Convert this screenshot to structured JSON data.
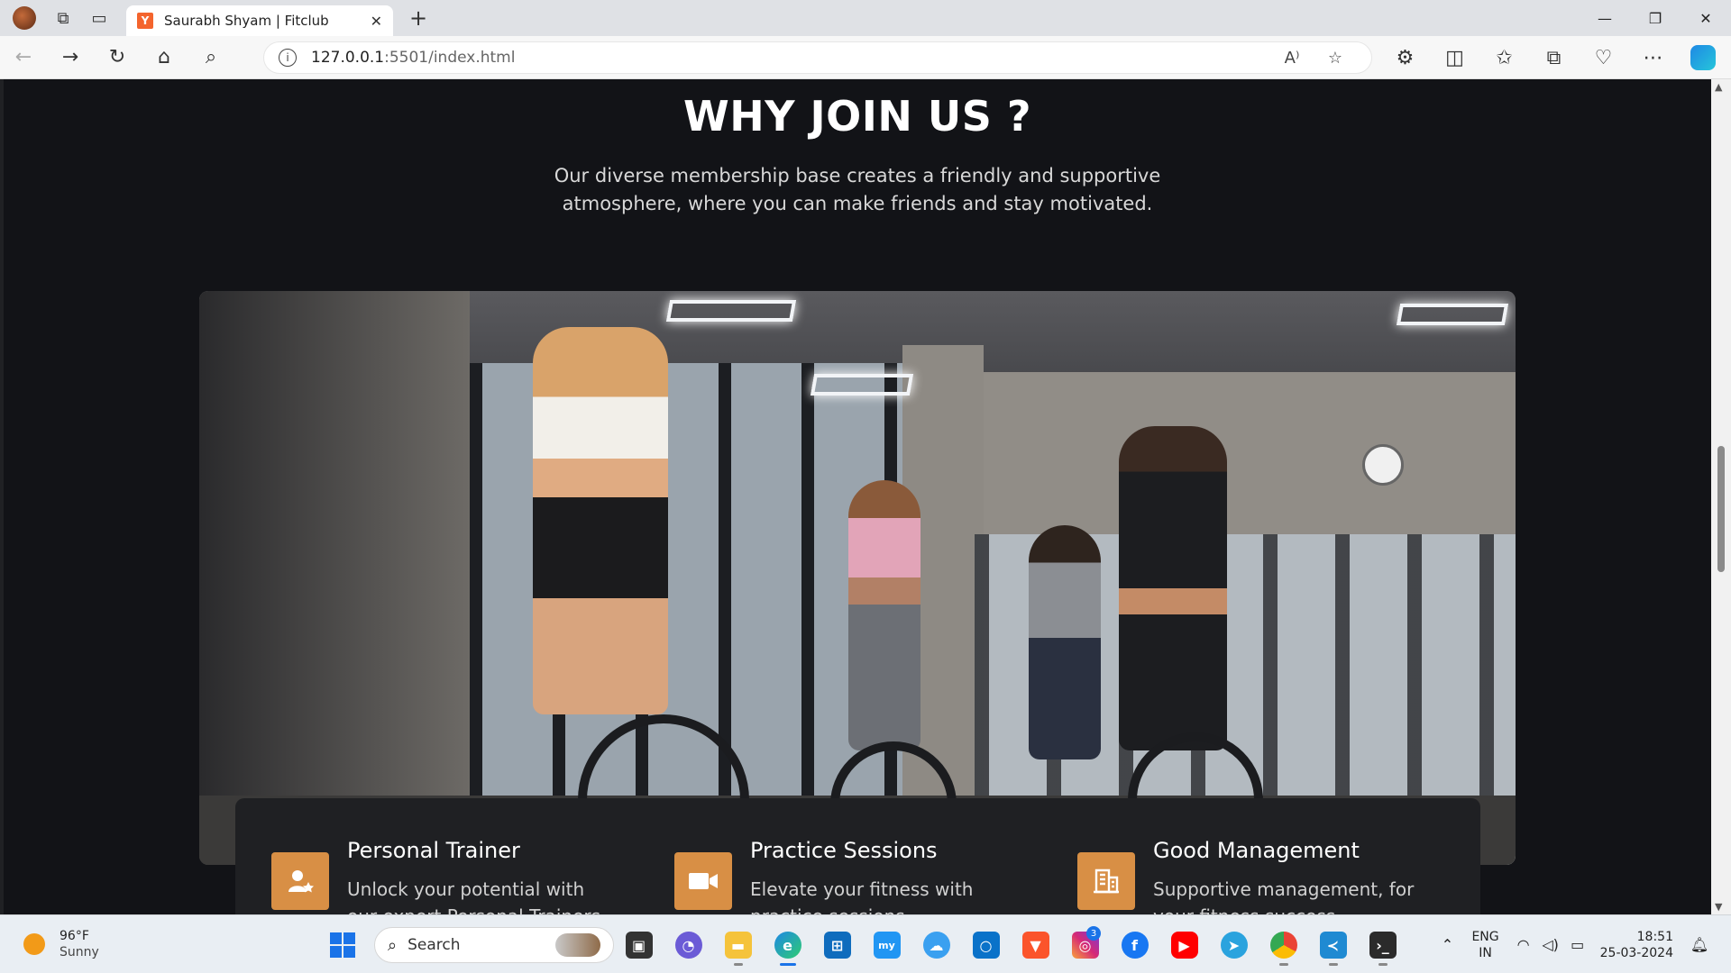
{
  "browser": {
    "tab_title": "Saurabh Shyam | Fitclub",
    "tab_favicon_letter": "Y",
    "url_host": "127.0.0.1",
    "url_rest": ":5501/index.html"
  },
  "section": {
    "title": "WHY JOIN US ?",
    "text": "Our diverse membership base creates a friendly and supportive atmosphere, where you can make friends and stay motivated."
  },
  "features": [
    {
      "title": "Personal Trainer",
      "desc": "Unlock your potential with our expert Personal Trainers",
      "icon": "trainer-icon"
    },
    {
      "title": "Practice Sessions",
      "desc": "Elevate your fitness with practice sessions",
      "icon": "video-camera-icon"
    },
    {
      "title": "Good Management",
      "desc": "Supportive management, for your fitness success",
      "icon": "building-icon"
    }
  ],
  "taskbar": {
    "weather_temp": "96°F",
    "weather_cond": "Sunny",
    "search_label": "Search",
    "instagram_badge": "3",
    "lang_line1": "ENG",
    "lang_line2": "IN",
    "time": "18:51",
    "date": "25-03-2024"
  },
  "colors": {
    "page_bg": "#121317",
    "accent": "#d88f45",
    "card_bg": "#1f2023"
  }
}
